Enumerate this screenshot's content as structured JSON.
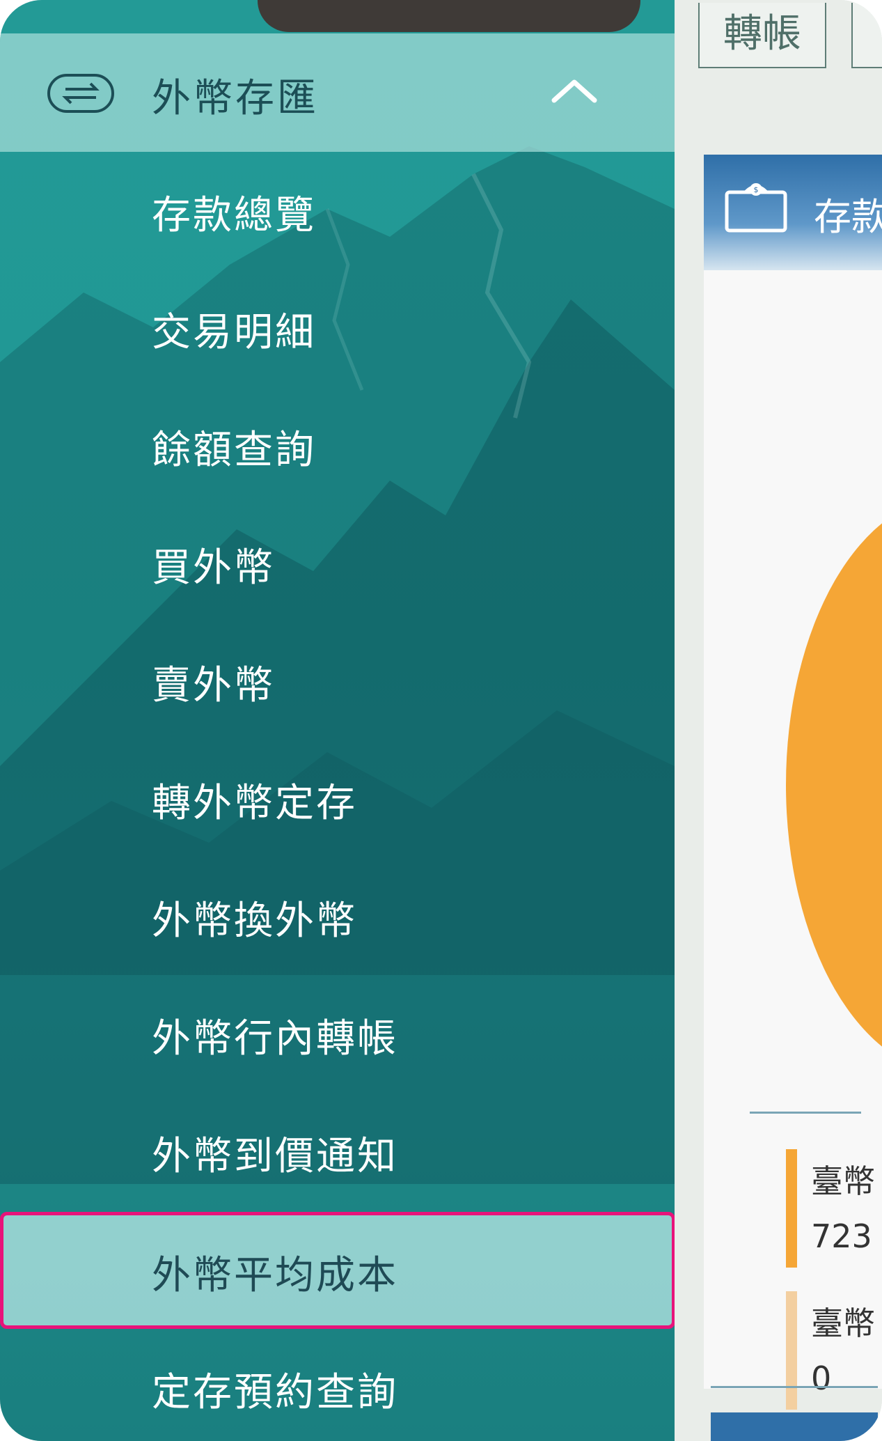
{
  "top_tabs": {
    "transfer": "轉帳"
  },
  "deposit_card": {
    "title": "存款"
  },
  "legend": [
    {
      "name": "臺幣",
      "value": "723",
      "color": "#f5a636"
    },
    {
      "name": "臺幣",
      "value": "0",
      "color": "#f3cfa0"
    }
  ],
  "drawer": {
    "header": {
      "title": "外幣存匯",
      "icon": "fx-exchange-icon",
      "toggle_icon": "chevron-up-icon"
    },
    "items": [
      {
        "label": "存款總覽"
      },
      {
        "label": "交易明細"
      },
      {
        "label": "餘額查詢"
      },
      {
        "label": "買外幣"
      },
      {
        "label": "賣外幣"
      },
      {
        "label": "轉外幣定存"
      },
      {
        "label": "外幣換外幣"
      },
      {
        "label": "外幣行內轉帳"
      },
      {
        "label": "外幣到價通知"
      },
      {
        "label": "外幣平均成本",
        "highlighted": true
      },
      {
        "label": "定存預約查詢"
      }
    ]
  },
  "colors": {
    "drawer_teal": "#1f9794",
    "highlight_border": "#e8137a",
    "orange": "#f5a636",
    "blue": "#2f6fa8"
  }
}
